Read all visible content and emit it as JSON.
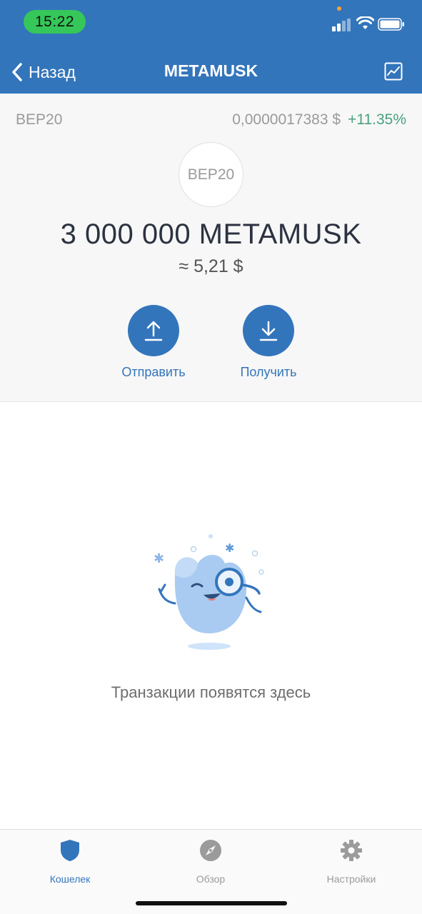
{
  "status_bar": {
    "time": "15:22"
  },
  "nav": {
    "back_label": "Назад",
    "title": "METAMUSK"
  },
  "token": {
    "network": "BEP20",
    "price": "0,0000017383 $",
    "change": "+11.35%",
    "logo_text": "BEP20",
    "balance": "3 000 000 METAMUSK",
    "fiat_value": "≈ 5,21 $"
  },
  "actions": {
    "send_label": "Отправить",
    "receive_label": "Получить"
  },
  "empty_state": {
    "message": "Транзакции появятся здесь"
  },
  "tabbar": {
    "items": [
      {
        "label": "Кошелек",
        "icon": "shield-icon",
        "active": true
      },
      {
        "label": "Обзор",
        "icon": "compass-icon",
        "active": false
      },
      {
        "label": "Настройки",
        "icon": "gear-icon",
        "active": false
      }
    ]
  },
  "colors": {
    "primary": "#3375bb",
    "positive": "#4aa17e",
    "time_pill": "#35c759"
  }
}
